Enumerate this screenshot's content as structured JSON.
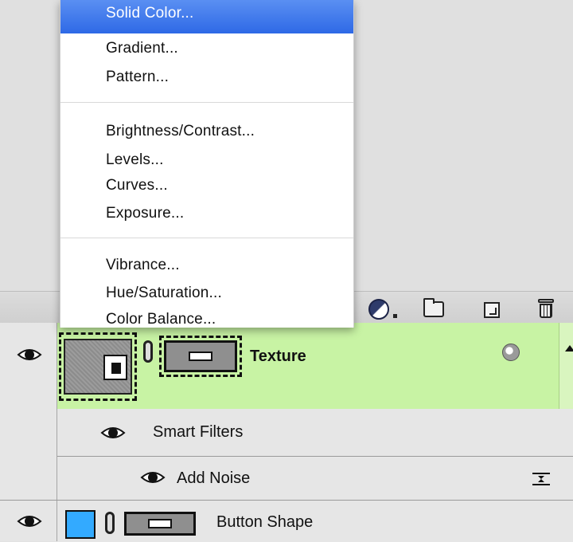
{
  "adjustment_menu": {
    "items": [
      {
        "label": "Solid Color..."
      },
      {
        "label": "Gradient..."
      },
      {
        "label": "Pattern..."
      },
      {
        "label": "Brightness/Contrast..."
      },
      {
        "label": "Levels..."
      },
      {
        "label": "Curves..."
      },
      {
        "label": "Exposure..."
      },
      {
        "label": "Vibrance..."
      },
      {
        "label": "Hue/Saturation..."
      },
      {
        "label": "Color Balance..."
      }
    ],
    "selected_index": 0,
    "highlight_color": "#3a74ea"
  },
  "toolbar": {
    "icons": [
      "adjustment-layer-icon",
      "new-group-folder-icon",
      "new-layer-icon",
      "trash-icon"
    ]
  },
  "layers": {
    "texture": {
      "name": "Texture",
      "highlight_color": "#c8f3a4"
    },
    "smart_filters": {
      "label": "Smart Filters"
    },
    "add_noise": {
      "label": "Add Noise"
    },
    "button_shape": {
      "name": "Button Shape",
      "fill_color": "#33aaff"
    }
  }
}
